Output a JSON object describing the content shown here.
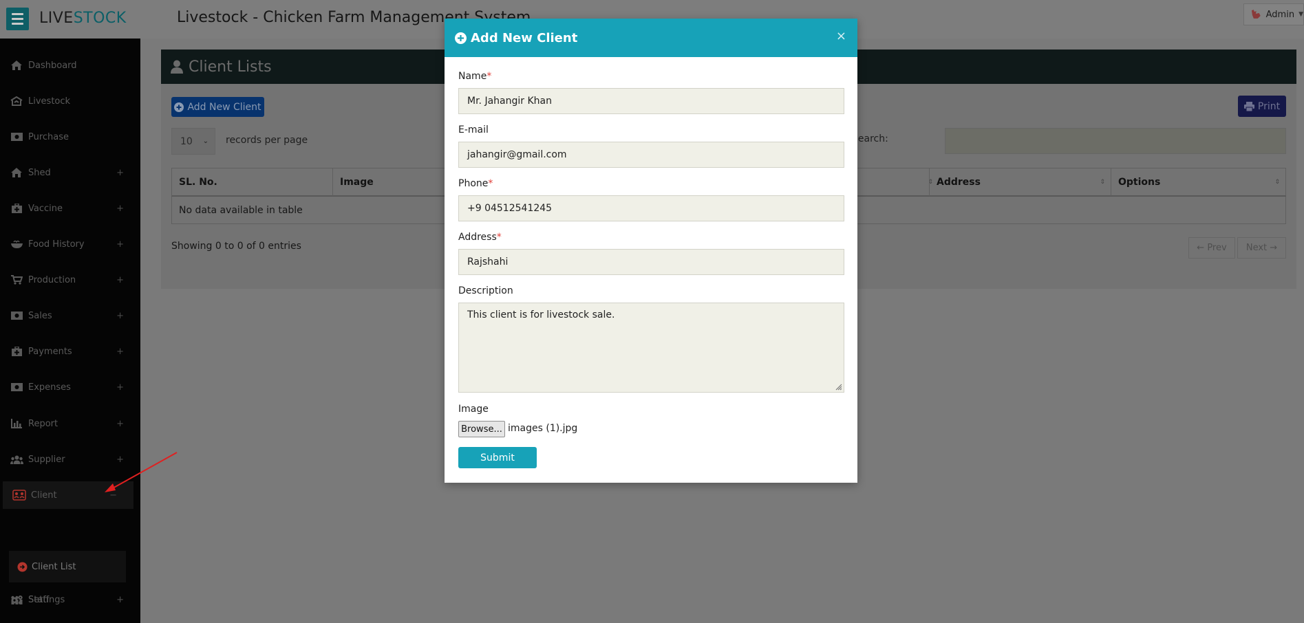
{
  "app": {
    "logo_part1": "LIVE",
    "logo_part2": "STOCK",
    "title": "Livestock - Chicken Farm Management System",
    "user": "Admin"
  },
  "sidebar": {
    "items": [
      {
        "label": "Dashboard",
        "icon": "home-icon",
        "expand": ""
      },
      {
        "label": "Livestock",
        "icon": "livestock-icon",
        "expand": ""
      },
      {
        "label": "Purchase",
        "icon": "money-icon",
        "expand": ""
      },
      {
        "label": "Shed",
        "icon": "home-icon",
        "expand": "+"
      },
      {
        "label": "Vaccine",
        "icon": "medkit-icon",
        "expand": "+"
      },
      {
        "label": "Food History",
        "icon": "food-bowl-icon",
        "expand": "+"
      },
      {
        "label": "Production",
        "icon": "cart-icon",
        "expand": "+"
      },
      {
        "label": "Sales",
        "icon": "money-icon",
        "expand": "+"
      },
      {
        "label": "Payments",
        "icon": "medkit-icon",
        "expand": "+"
      },
      {
        "label": "Expenses",
        "icon": "money-icon",
        "expand": "+"
      },
      {
        "label": "Report",
        "icon": "bar-chart-icon",
        "expand": "+"
      },
      {
        "label": "Supplier",
        "icon": "users-icon",
        "expand": "+"
      },
      {
        "label": "Client",
        "icon": "client-group-icon",
        "expand": "−"
      },
      {
        "label": "Staff",
        "icon": "staff-icon",
        "expand": "+"
      },
      {
        "label": "Settings",
        "icon": "cogs-icon",
        "expand": "+"
      }
    ],
    "sub_item": "Client List",
    "client_accent": "#d9362e"
  },
  "page": {
    "title": "Client Lists",
    "add_button": "Add New Client",
    "print_button": "Print",
    "per_page": "10",
    "per_page_label": "records per page",
    "search_label": "Search:",
    "columns": [
      "SL. No.",
      "Image",
      "Address",
      "Options"
    ],
    "empty_message": "No data available in table",
    "showing": "Showing 0 to 0 of 0 entries",
    "prev": "← Prev",
    "next": "Next →"
  },
  "modal": {
    "title": "Add New Client",
    "close": "×",
    "name_label": "Name",
    "name_value": "Mr. Jahangir Khan",
    "email_label": "E-mail",
    "email_value": "jahangir@gmail.com",
    "phone_label": "Phone",
    "phone_value": "+9 04512541245",
    "address_label": "Address",
    "address_value": "Rajshahi",
    "description_label": "Description",
    "description_value": "This client is for livestock sale.",
    "image_label": "Image",
    "browse": "Browse...",
    "file_name": "images (1).jpg",
    "submit": "Submit",
    "required_mark": "*",
    "accent": "#17a2b8"
  }
}
